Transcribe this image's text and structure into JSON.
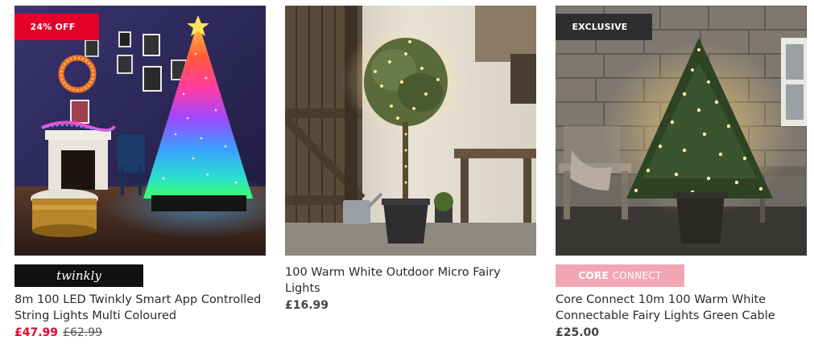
{
  "products": [
    {
      "badge": "24% OFF",
      "brand": "twinkly",
      "title": "8m 100 LED Twinkly Smart App Controlled String Lights Multi Coloured",
      "price": "£47.99",
      "was_price": "£62.99",
      "colors": {
        "badge": "#e5002a",
        "price": "#e5002a"
      }
    },
    {
      "title": "100 Warm White Outdoor Micro Fairy Lights",
      "price": "£16.99"
    },
    {
      "badge": "EXCLUSIVE",
      "brand_part1": "CORE",
      "brand_part2": "CONNECT",
      "title": "Core Connect 10m 100 Warm White Connectable Fairy Lights Green Cable",
      "price": "£25.00",
      "colors": {
        "badge": "#2e2e2e",
        "brand_bar": "#f2a6b3"
      }
    }
  ]
}
